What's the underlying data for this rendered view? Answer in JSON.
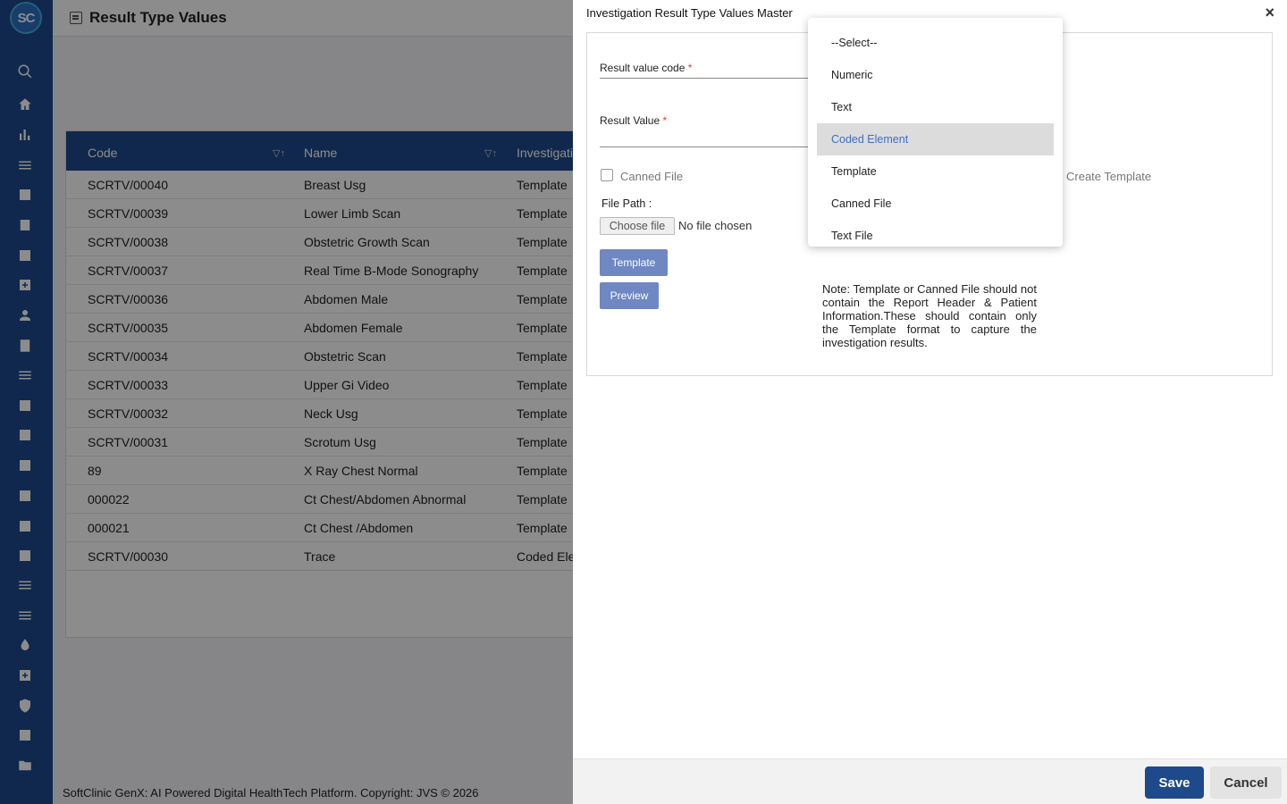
{
  "app": {
    "logo_text": "SC",
    "page_title": "Result Type Values",
    "footer": "SoftClinic GenX: AI Powered Digital HealthTech Platform. Copyright: JVS © 2026"
  },
  "sidebar": {
    "icons": [
      "search-icon",
      "home-icon",
      "bar-chart-icon",
      "menu-icon",
      "badge-icon",
      "calendar-icon",
      "bed-icon",
      "medical-plus-icon",
      "person-icon",
      "document-icon",
      "list-icon",
      "pharmacy-icon",
      "medicine-box-icon",
      "book-icon",
      "building-icon",
      "devices-icon",
      "wrench-icon",
      "lines-icon",
      "lines-alt-icon",
      "drop-icon",
      "add-box-icon",
      "shield-icon",
      "network-icon",
      "folder-icon"
    ]
  },
  "table": {
    "columns": [
      "Code",
      "Name",
      "Investigatio"
    ],
    "rows": [
      {
        "code": "SCRTV/00040",
        "name": "Breast Usg",
        "type": "Template"
      },
      {
        "code": "SCRTV/00039",
        "name": "Lower Limb Scan",
        "type": "Template"
      },
      {
        "code": "SCRTV/00038",
        "name": "Obstetric Growth Scan",
        "type": "Template"
      },
      {
        "code": "SCRTV/00037",
        "name": "Real Time B-Mode Sonography",
        "type": "Template"
      },
      {
        "code": "SCRTV/00036",
        "name": "Abdomen Male",
        "type": "Template"
      },
      {
        "code": "SCRTV/00035",
        "name": "Abdomen Female",
        "type": "Template"
      },
      {
        "code": "SCRTV/00034",
        "name": "Obstetric Scan",
        "type": "Template"
      },
      {
        "code": "SCRTV/00033",
        "name": "Upper Gi Video",
        "type": "Template"
      },
      {
        "code": "SCRTV/00032",
        "name": "Neck Usg",
        "type": "Template"
      },
      {
        "code": "SCRTV/00031",
        "name": "Scrotum Usg",
        "type": "Template"
      },
      {
        "code": "89",
        "name": "X Ray Chest Normal",
        "type": "Template"
      },
      {
        "code": "000022",
        "name": "Ct Chest/Abdomen Abnormal",
        "type": "Template"
      },
      {
        "code": "000021",
        "name": "Ct Chest /Abdomen",
        "type": "Template"
      },
      {
        "code": "SCRTV/00030",
        "name": "Trace",
        "type": "Coded Ele"
      }
    ]
  },
  "modal": {
    "title": "Investigation Result Type Values Master",
    "close": "×",
    "result_value_code_label": "Result value code",
    "result_value_label": "Result Value",
    "required_mark": "*",
    "canned_file_label": "Canned File",
    "create_template_label": "Create Template",
    "file_path_label": "File Path :",
    "choose_file": "Choose file",
    "no_file": "No file chosen",
    "template_button": "Template",
    "preview_button": "Preview",
    "note": "Note: Template or Canned File should not contain the Report Header & Patient Information.These should contain only the Template format to capture the investigation results.",
    "save": "Save",
    "cancel": "Cancel"
  },
  "dropdown": {
    "options": [
      "--Select--",
      "Numeric",
      "Text",
      "Coded Element",
      "Template",
      "Canned File",
      "Text File"
    ],
    "selected": "Coded Element"
  },
  "colors": {
    "primary": "#1e4a8c",
    "selected_option_text": "#3f6fc9",
    "required": "#e53935"
  }
}
